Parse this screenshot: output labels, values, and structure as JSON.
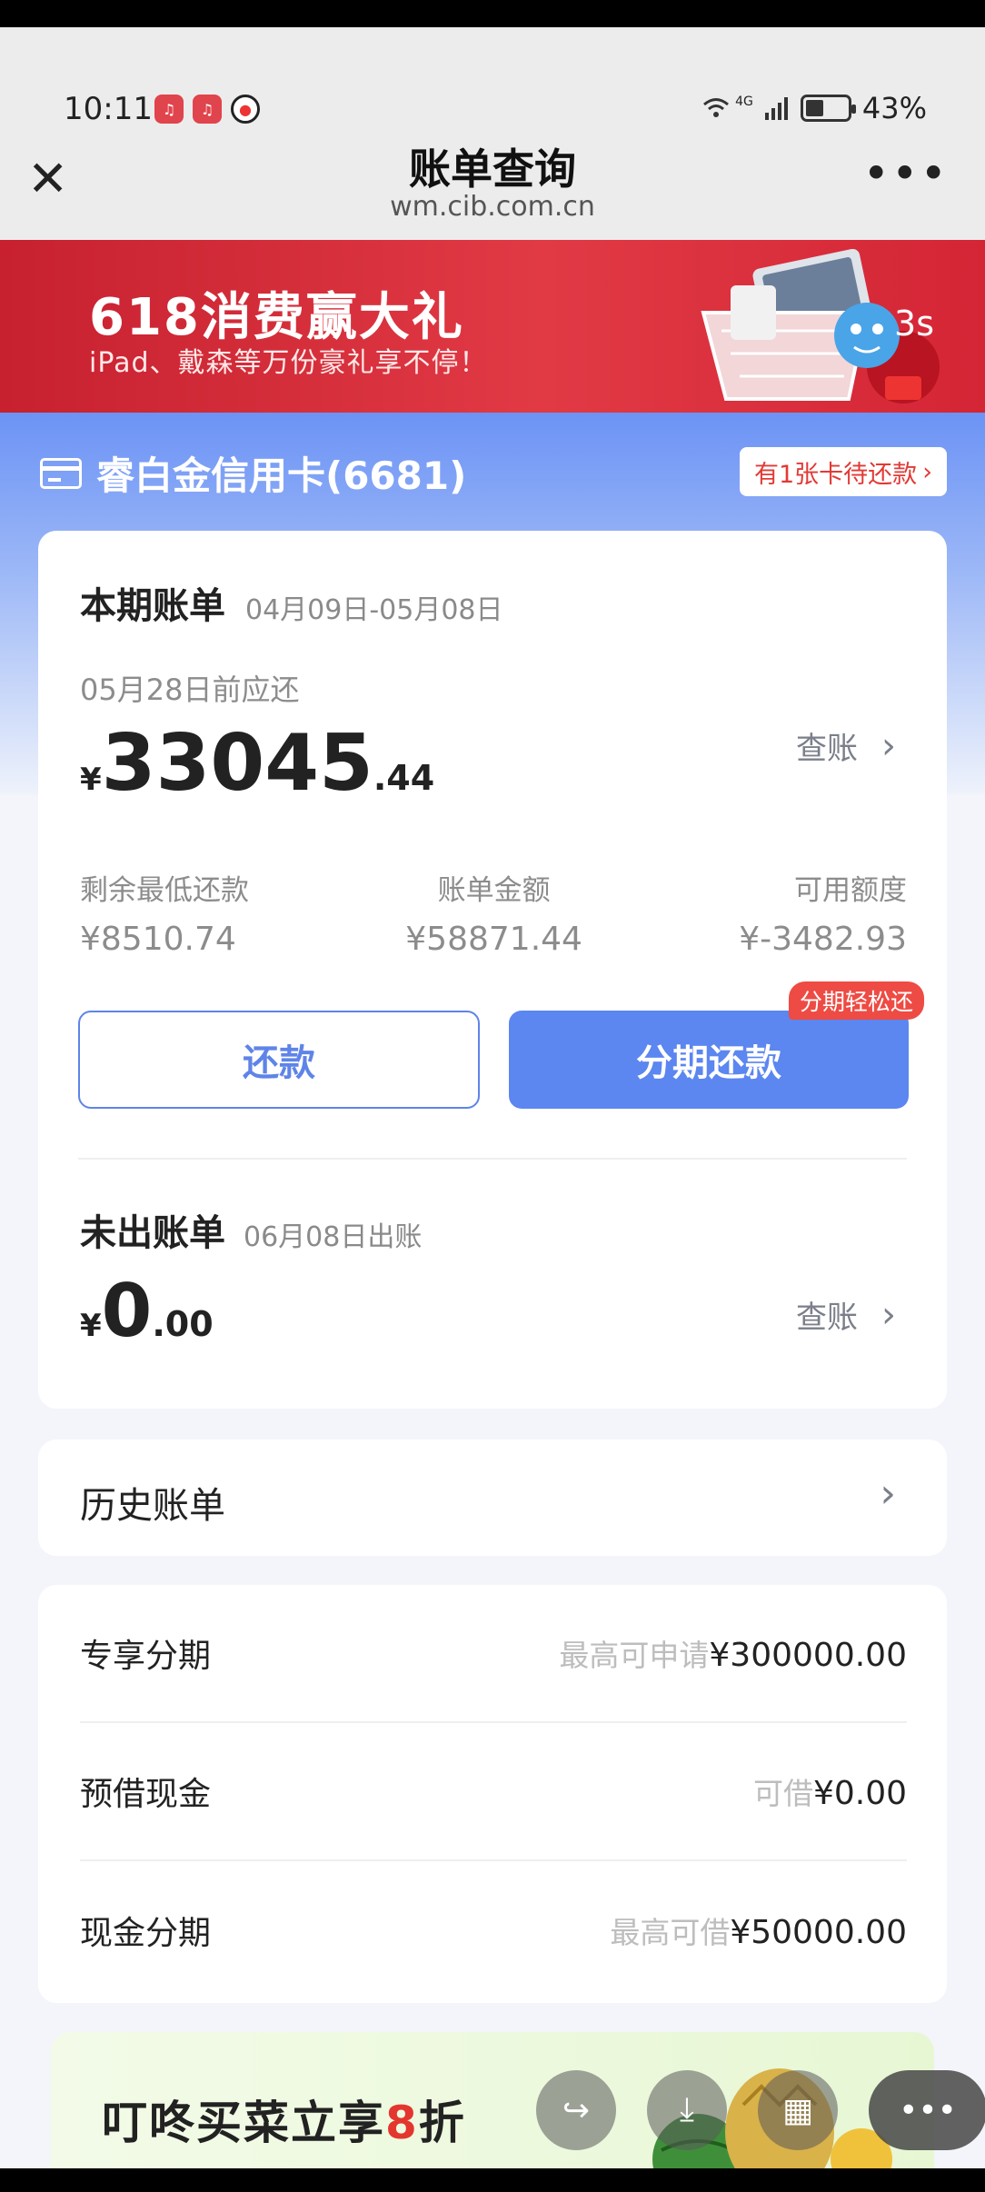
{
  "status_bar": {
    "time": "10:11",
    "network": "4G",
    "battery": "43%",
    "battery_level": 0.43
  },
  "nav": {
    "title": "账单查询",
    "url": "wm.cib.com.cn"
  },
  "banner": {
    "title": "618消费赢大礼",
    "subtitle": "iPad、戴森等万份豪礼享不停！",
    "countdown": "3s"
  },
  "card": {
    "name": "睿白金信用卡(6681)",
    "pending_label": "有1张卡待还款"
  },
  "current_bill": {
    "title": "本期账单",
    "period": "04月09日-05月08日",
    "due_text": "05月28日前应还",
    "currency": "¥",
    "amount_int": "33045",
    "amount_dec": ".44",
    "check_label": "查账",
    "stats": [
      {
        "label": "剩余最低还款",
        "value": "¥8510.74"
      },
      {
        "label": "账单金额",
        "value": "¥58871.44"
      },
      {
        "label": "可用额度",
        "value": "¥-3482.93"
      }
    ],
    "repay_label": "还款",
    "installment_label": "分期还款",
    "installment_badge": "分期轻松还"
  },
  "unbilled": {
    "title": "未出账单",
    "date_text": "06月08日出账",
    "currency": "¥",
    "amount_int": "0",
    "amount_dec": ".00",
    "check_label": "查账"
  },
  "history": {
    "label": "历史账单"
  },
  "services": [
    {
      "label": "专享分期",
      "prefix": "最高可申请",
      "value": "¥300000.00"
    },
    {
      "label": "预借现金",
      "prefix": "可借",
      "value": "¥0.00"
    },
    {
      "label": "现金分期",
      "prefix": "最高可借",
      "value": "¥50000.00"
    }
  ],
  "promo": {
    "text_before": "叮咚买菜立享",
    "highlight": "8",
    "text_after": "折"
  },
  "colors": {
    "accent": "#5c86f0",
    "banner_red": "#d42535",
    "alert_red": "#ee4b44"
  },
  "floating_actions": [
    "share-icon",
    "download-icon",
    "grid-icon",
    "more-icon"
  ]
}
